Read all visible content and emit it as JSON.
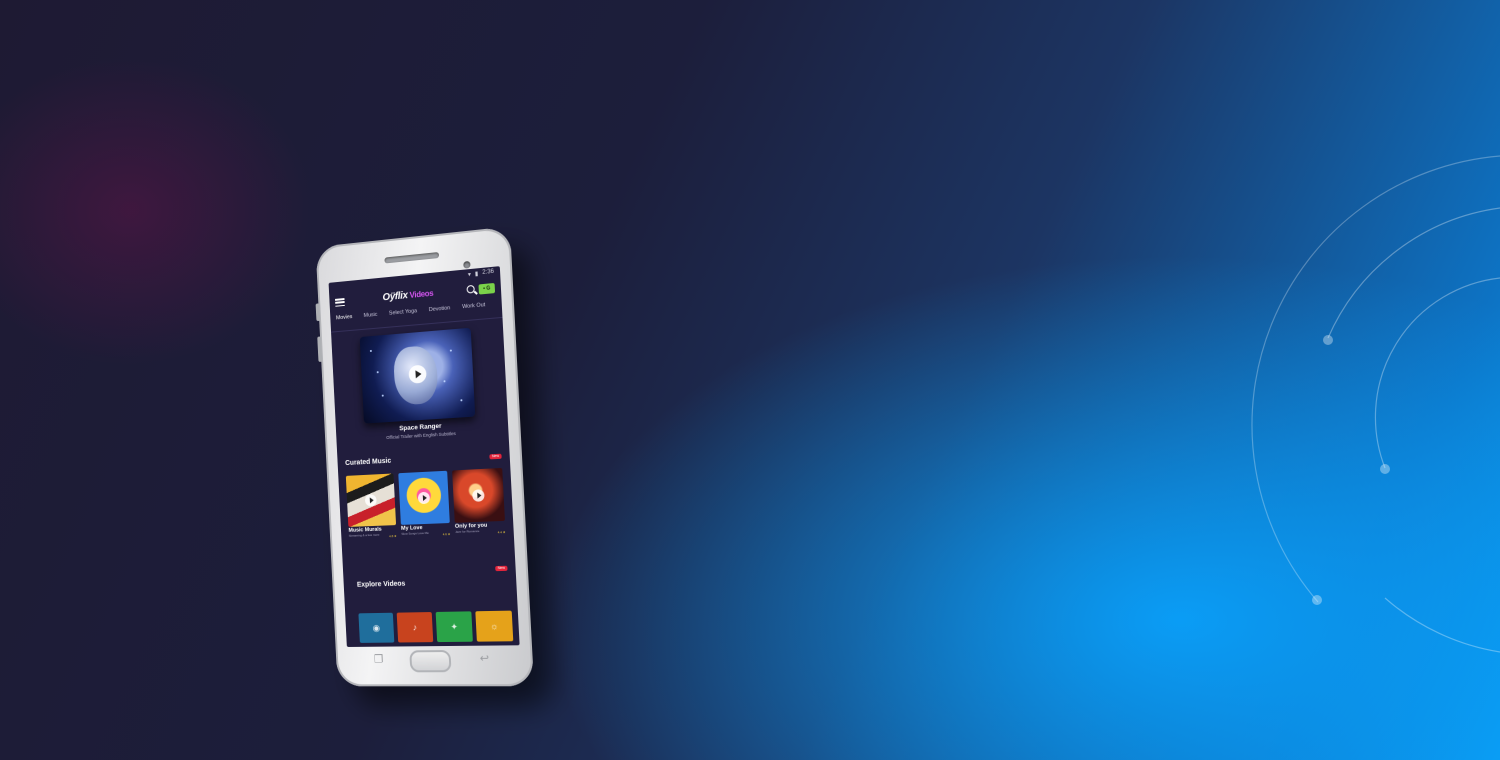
{
  "status_bar": {
    "time": "2:36"
  },
  "app": {
    "logo_main": "Oÿflix",
    "logo_sub": "Videos",
    "user_badge": "• G"
  },
  "tabs": [
    "Movies",
    "Music",
    "Select Yoga",
    "Devotion",
    "Work Out"
  ],
  "hero": {
    "title": "Space Ranger",
    "subtitle": "Official Trailer with English Subtitles"
  },
  "curated": {
    "heading": "Curated Music",
    "badge": "New",
    "items": [
      {
        "title": "Music Murals",
        "subtitle": "Streaming & a few more",
        "rating": "4.8 ★"
      },
      {
        "title": "My Love",
        "subtitle": "Slow Songs Love Me",
        "rating": "4.6 ★"
      },
      {
        "title": "Only for you",
        "subtitle": "Jazz for Romance",
        "rating": "4.4 ★"
      }
    ]
  },
  "explore": {
    "heading": "Explore Videos",
    "badge": "New",
    "tiles": [
      "camera-icon",
      "music-note-icon",
      "sparkle-icon",
      "bulb-icon"
    ]
  },
  "colors": {
    "screen_bg": "#211d3d",
    "accent": "#d455f0",
    "new_badge": "#e3243b",
    "user_badge": "#7bd24a"
  }
}
